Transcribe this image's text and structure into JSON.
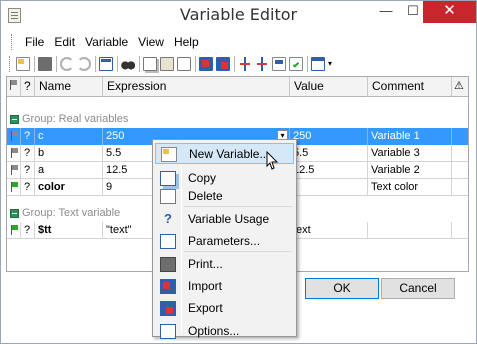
{
  "window": {
    "title": "Variable Editor"
  },
  "titlebar": {
    "minimize": "—",
    "maximize": "☐",
    "close": "✕"
  },
  "menu": [
    "File",
    "Edit",
    "Variable",
    "View",
    "Help"
  ],
  "grid": {
    "headers": {
      "flag": "",
      "lock": "?",
      "name": "Name",
      "expression": "Expression",
      "value": "Value",
      "comment": "Comment",
      "warn": "⚠"
    },
    "groups": [
      {
        "label": "Group: Real variables",
        "rows": [
          {
            "flag": "grey",
            "lock": "?",
            "name": "c",
            "expression": "250",
            "value": "250",
            "comment": "Variable 1",
            "selected": true
          },
          {
            "flag": "grey",
            "lock": "?",
            "name": "b",
            "expression": "5.5",
            "value": "5.5",
            "comment": "Variable 3"
          },
          {
            "flag": "grey",
            "lock": "?",
            "name": "a",
            "expression": "12.5",
            "value": "12.5",
            "comment": "Variable 2"
          },
          {
            "flag": "green",
            "lock": "?",
            "name": "color",
            "expression": "9",
            "value": "",
            "comment": "Text color",
            "bold": true
          }
        ]
      },
      {
        "label": "Group: Text variable",
        "rows": [
          {
            "flag": "green",
            "lock": "?",
            "name": "$tt",
            "expression": "\"text\"",
            "value": "text",
            "comment": "",
            "bold": true
          }
        ]
      }
    ]
  },
  "buttons": {
    "ok": "OK",
    "cancel": "Cancel"
  },
  "context_menu": {
    "items": [
      {
        "label": "New Variable...",
        "icon": "new-variable-icon",
        "hover": true
      },
      {
        "label": "Copy",
        "icon": "copy-icon"
      },
      {
        "label": "Delete",
        "icon": "delete-icon"
      },
      {
        "label": "Variable Usage",
        "icon": "question-icon"
      },
      {
        "label": "Parameters...",
        "icon": "parameters-icon"
      },
      {
        "label": "Print...",
        "icon": "print-icon"
      },
      {
        "label": "Import",
        "icon": "import-icon"
      },
      {
        "label": "Export",
        "icon": "export-icon"
      },
      {
        "label": "Options...",
        "icon": "options-icon"
      }
    ]
  },
  "colors": {
    "selection": "#3399ff",
    "close": "#c8252c",
    "group_text": "#8c8c8c"
  }
}
